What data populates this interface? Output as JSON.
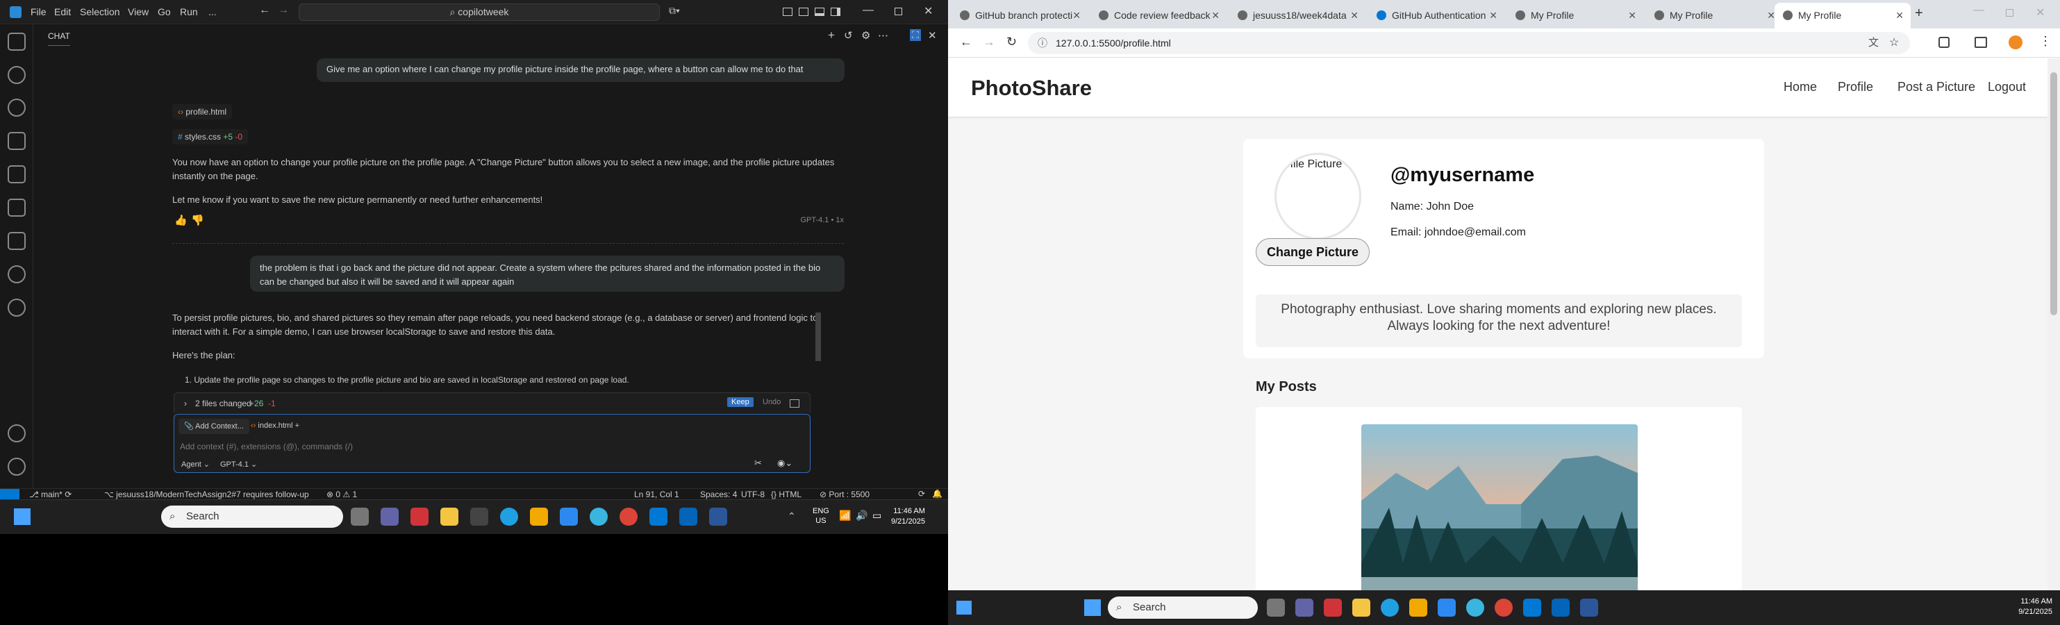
{
  "vscode": {
    "menu": [
      "File",
      "Edit",
      "Selection",
      "View",
      "Go",
      "Run",
      "..."
    ],
    "search": "copilotweek",
    "panel_title": "CHAT",
    "user_msg_1": "Give me an option where I can change my profile picture inside the profile page, where a button can allow me to do that",
    "file_1": "profile.html",
    "file_2": "styles.css",
    "file_2_diff_add": "+5",
    "file_2_diff_del": "-0",
    "resp_1a": "You now have an option to change your profile picture on the profile page. A \"Change Picture\" button allows you to select a new image, and the profile picture updates instantly on the page.",
    "resp_1b": "Let me know if you want to save the new picture permanently or need further enhancements!",
    "model_tag": "GPT-4.1 • 1x",
    "user_msg_2": "the problem is that i go back and the picture did not appear. Create a system where the pcitures shared and the information posted in the bio can be changed but also it will be saved and it will appear again",
    "resp_2a": "To persist profile pictures, bio, and shared pictures so they remain after page reloads, you need backend storage (e.g., a database or server) and frontend logic to interact with it. For a simple demo, I can use browser localStorage to save and restore this data.",
    "resp_2b": "Here's the plan:",
    "resp_2c": "1. Update the profile page so changes to the profile picture and bio are saved in localStorage and restored on page load.",
    "changes": "2 files changed",
    "changes_add": "+26",
    "changes_del": "-1",
    "keep": "Keep",
    "undo": "Undo",
    "add_context": "Add Context...",
    "ctx_file": "index.html",
    "input_placeholder": "Add context (#), extensions (@), commands (/)",
    "agent": "Agent",
    "model": "GPT-4.1",
    "status": {
      "branch": "main*",
      "repo": "jesuuss18/ModernTechAssign2#7 requires follow-up",
      "problems": "0",
      "warnings": "1",
      "pos": "Ln 91, Col 1",
      "spaces": "Spaces: 4",
      "enc": "UTF-8",
      "lang": "HTML",
      "port": "Port : 5500"
    },
    "taskbar": {
      "search": "Search",
      "lang1": "ENG",
      "lang2": "US",
      "time": "11:46 AM",
      "date": "9/21/2025"
    }
  },
  "chrome": {
    "tabs": [
      "GitHub branch protecti",
      "Code review feedback",
      "jesuuss18/week4data",
      "GitHub Authentication",
      "My Profile",
      "My Profile",
      "My Profile"
    ],
    "url": "127.0.0.1:5500/profile.html",
    "brand": "PhotoShare",
    "nav": [
      "Home",
      "Profile",
      "Post a Picture",
      "Logout"
    ],
    "avatar_alt": "Profile Picture",
    "change_btn": "Change Picture",
    "username": "@myusername",
    "name": "Name: John Doe",
    "email": "Email: johndoe@email.com",
    "bio": "Photography enthusiast. Love sharing moments and exploring new places. Always looking for the next adventure!",
    "posts_heading": "My Posts",
    "taskbar": {
      "search": "Search",
      "time": "11:46 AM",
      "date": "9/21/2025"
    }
  },
  "colors": {
    "accent": "#2f6fbf",
    "vs_bg": "#181818",
    "diff_add": "#73c991",
    "diff_del": "#f14c4c"
  }
}
